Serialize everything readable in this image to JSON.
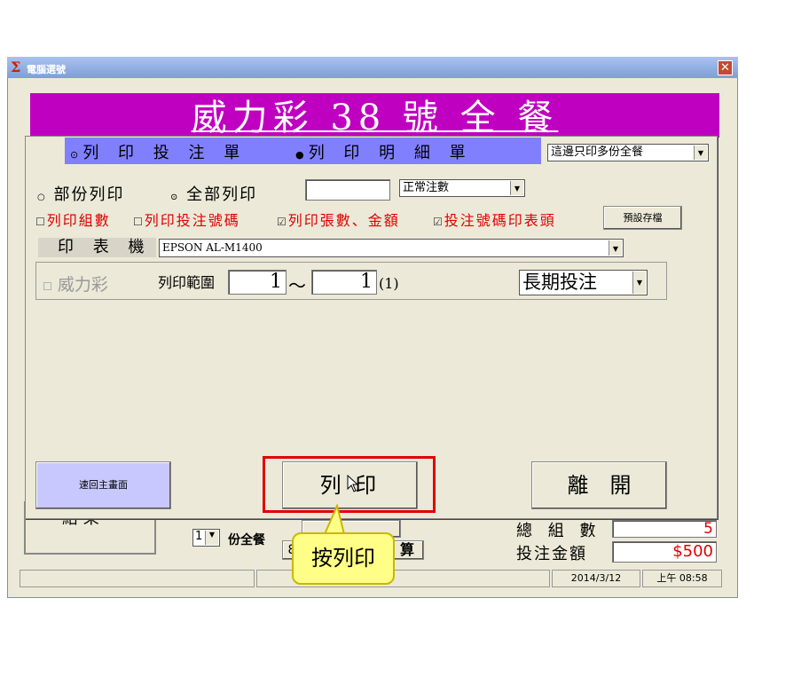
{
  "window": {
    "title": "電腦選號",
    "close_label": "✕"
  },
  "banner": {
    "text": "威力彩 38 號 全 餐"
  },
  "print_options": {
    "radio_print_ticket": "列 印 投 注 單",
    "radio_print_detail": "列 印 明 細 單",
    "copies_select": "這邊只印多份全餐",
    "radio_partial": "部份列印",
    "radio_all": "全部列印",
    "count_input": "",
    "count_select": "正常注數",
    "chk_print_groups": "列印組數",
    "chk_print_numbers": "列印投注號碼",
    "chk_print_sheets": "列印張數、金額",
    "chk_print_header": "投注號碼印表頭",
    "save_default_button": "預設存檔"
  },
  "printer": {
    "label": "印 表 機",
    "value": "EPSON AL-M1400"
  },
  "range": {
    "chk_label": "威力彩",
    "label": "列印範圍",
    "from": "1",
    "tilde": "～",
    "to": "1",
    "count": "(1)",
    "term_select": "長期投注"
  },
  "buttons": {
    "back": "速回主畫面",
    "print": "列 印",
    "exit": "離　開"
  },
  "background_panel": {
    "result_label": "結 果",
    "copies_value": "1",
    "copies_suffix": "份全餐",
    "settle_button": "算",
    "hidden_btn1": "8",
    "total_groups_label": "總 組 數",
    "total_groups_value": "5",
    "amount_label": "投注金額",
    "amount_value": "$500"
  },
  "status_bar": {
    "date": "2014/3/12",
    "time": "上午 08:58"
  },
  "callout": {
    "text": "按列印"
  },
  "colors": {
    "banner": "#c000c0",
    "radio_bar": "#8080ff",
    "highlight": "#e00000",
    "callout": "#ffff88"
  }
}
